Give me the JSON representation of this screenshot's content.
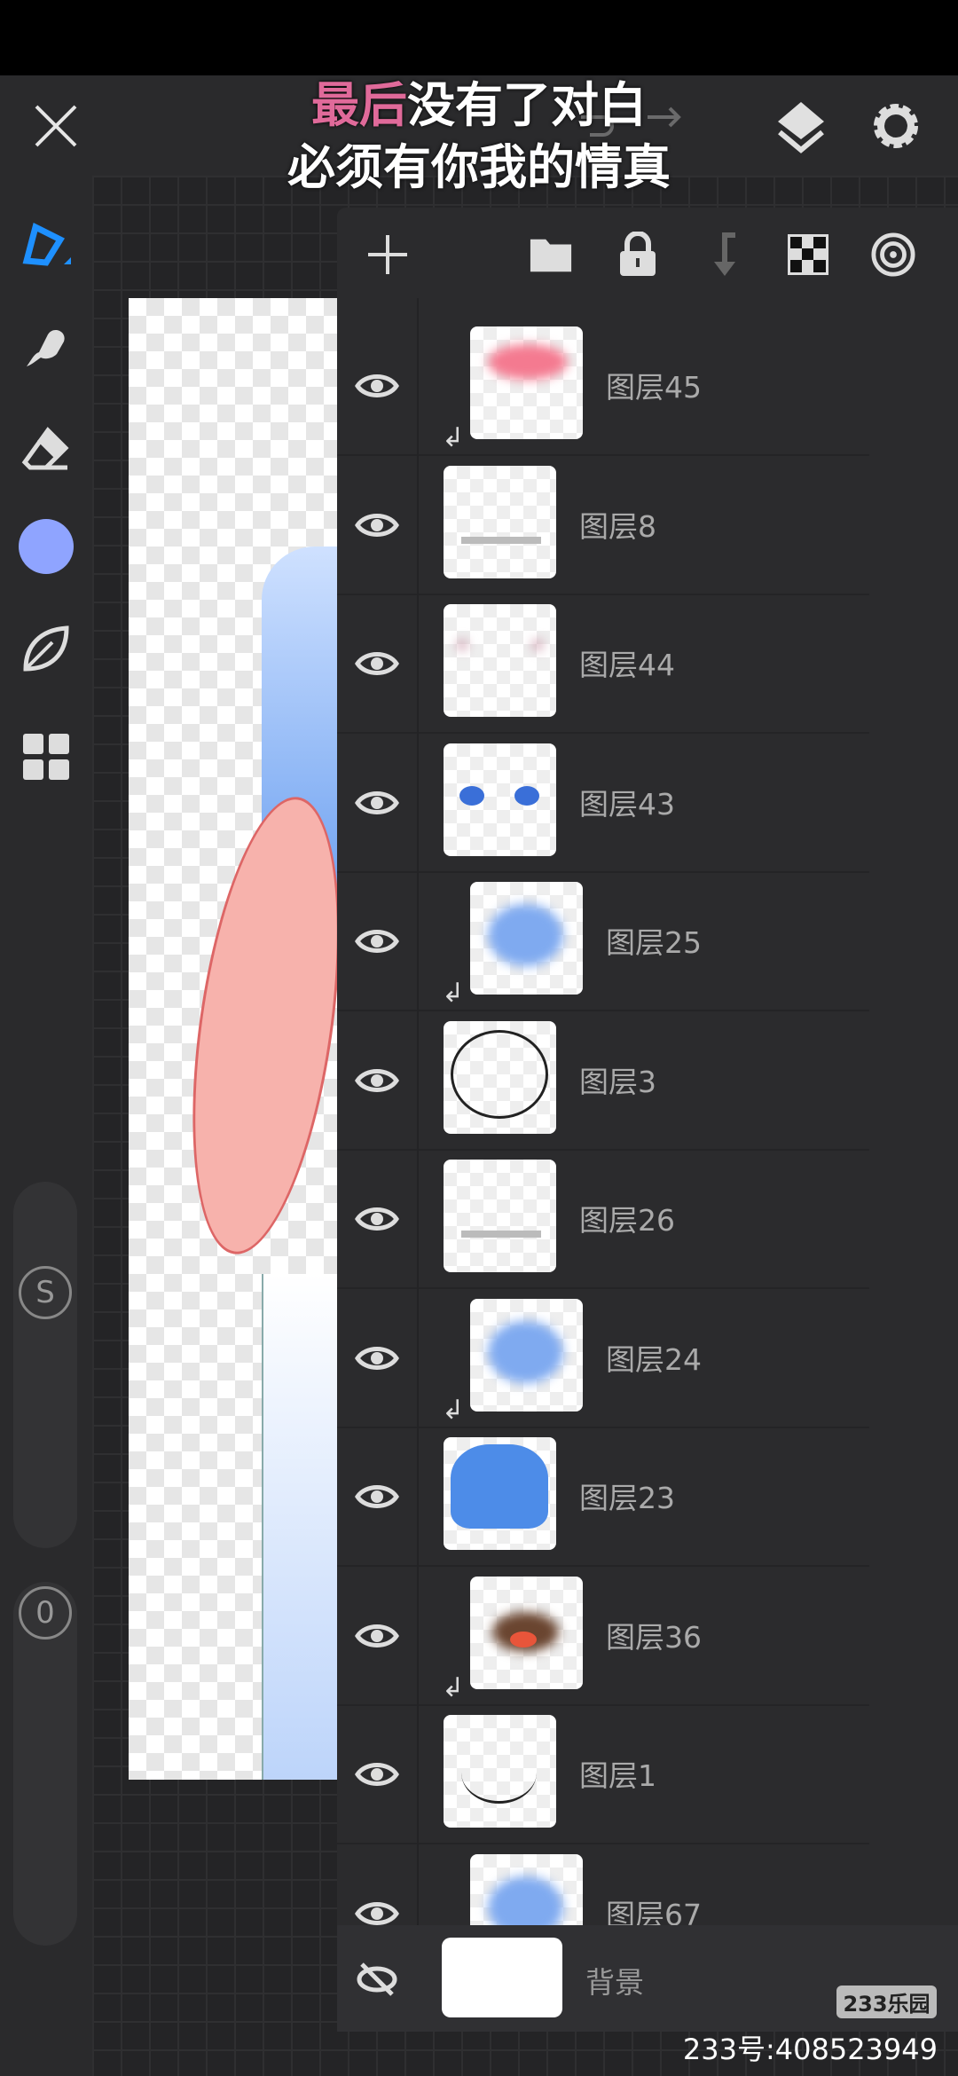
{
  "subtitle": {
    "line1_highlight": "最后",
    "line1_rest": "没有了对白",
    "line2": "必须有你我的情真",
    "highlight_color": "#e06a9a"
  },
  "accent_color": "#1e90ff",
  "brush_color": "#8fa4ff",
  "left_tools": [
    {
      "icon": "pen-icon"
    },
    {
      "icon": "smudge-icon"
    },
    {
      "icon": "eraser-icon"
    },
    {
      "icon": "color-icon"
    },
    {
      "icon": "leaf-icon"
    },
    {
      "icon": "grid-icon"
    }
  ],
  "sliders": {
    "size_label": "S",
    "opacity_label": "0"
  },
  "layers": [
    {
      "name": "图层45",
      "clipped": true,
      "thumb": "pink"
    },
    {
      "name": "图层8",
      "clipped": false,
      "thumb": "lines"
    },
    {
      "name": "图层44",
      "clipped": false,
      "thumb": "faint"
    },
    {
      "name": "图层43",
      "clipped": false,
      "thumb": "eyes"
    },
    {
      "name": "图层25",
      "clipped": true,
      "thumb": "blue"
    },
    {
      "name": "图层3",
      "clipped": false,
      "thumb": "hairline"
    },
    {
      "name": "图层26",
      "clipped": false,
      "thumb": "lines"
    },
    {
      "name": "图层24",
      "clipped": true,
      "thumb": "blue"
    },
    {
      "name": "图层23",
      "clipped": false,
      "thumb": "hairblue"
    },
    {
      "name": "图层36",
      "clipped": true,
      "thumb": "brown"
    },
    {
      "name": "图层1",
      "clipped": false,
      "thumb": "face"
    },
    {
      "name": "图层67",
      "clipped": true,
      "thumb": "blue"
    }
  ],
  "background_layer": {
    "name": "背景",
    "visible": false
  },
  "watermark": {
    "badge": "233乐园",
    "id": "233号:408523949"
  }
}
